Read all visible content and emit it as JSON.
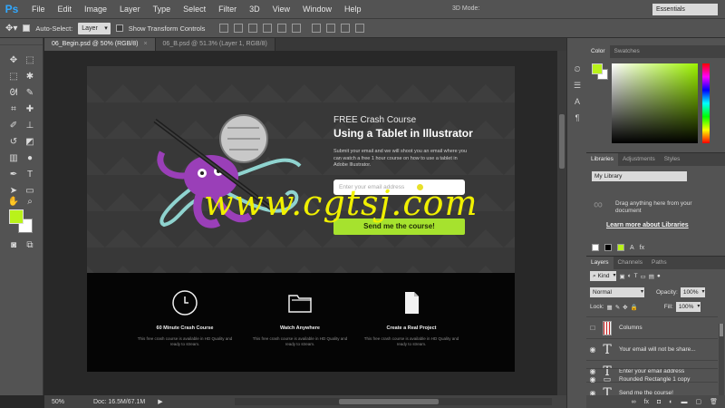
{
  "app": {
    "logo": "Ps",
    "menu": [
      "File",
      "Edit",
      "Image",
      "Layer",
      "Type",
      "Select",
      "Filter",
      "3D",
      "View",
      "Window",
      "Help"
    ],
    "window_controls": [
      "–",
      "□",
      "✕"
    ]
  },
  "options_bar": {
    "auto_select_label": "Auto-Select:",
    "auto_select_value": "Layer",
    "transform_label": "Show Transform Controls",
    "mode_3d_label": "3D Mode:",
    "workspace": "Essentials"
  },
  "tabs": [
    {
      "label": "06_Begin.psd @ 50% (RGB/8)",
      "active": true
    },
    {
      "label": "06_B.psd @ 51.3% (Layer 1, RGB/8)",
      "active": false
    }
  ],
  "tool_icons": [
    "move-icon",
    "marquee-icon",
    "lasso-icon",
    "quick-select-icon",
    "crop-icon",
    "eyedropper-icon",
    "healing-icon",
    "brush-icon",
    "stamp-icon",
    "history-brush-icon",
    "eraser-icon",
    "gradient-icon",
    "blur-icon",
    "dodge-icon",
    "pen-icon",
    "type-icon",
    "path-select-icon",
    "shape-icon",
    "hand-icon",
    "zoom-icon"
  ],
  "colors": {
    "foreground": "#b9f21a",
    "background": "#ffffff",
    "accent_button": "#a6e22e"
  },
  "document": {
    "hero": {
      "eyebrow": "FREE Crash Course",
      "title": "Using a Tablet in Illustrator",
      "description": "Submit your email and we will shoot you an email where you can watch a free 1 hour course on how to use a tablet in Adobe Illustrator.",
      "email_placeholder": "Enter your email address",
      "cta": "Send me the course!"
    },
    "features": [
      {
        "icon": "clock-icon",
        "title": "60 Minute Crash Course",
        "desc": "This free crash course is available in HD Quality and ready to stream."
      },
      {
        "icon": "folder-icon",
        "title": "Watch Anywhere",
        "desc": "This free crash course is available in HD Quality and ready to stream."
      },
      {
        "icon": "document-icon",
        "title": "Create a Real Project",
        "desc": "This free crash course is available in HD Quality and ready to stream."
      }
    ],
    "watermark": "www.cgtsj.com"
  },
  "status": {
    "zoom": "50%",
    "doc_size": "Doc: 16.5M/67.1M"
  },
  "panels": {
    "color_tabs": [
      "Color",
      "Swatches"
    ],
    "library_tabs": [
      "Libraries",
      "Adjustments",
      "Styles"
    ],
    "library_name": "My Library",
    "library_drag_text": "Drag anything here from your document",
    "library_learn": "Learn more about Libraries",
    "layers_tabs": [
      "Layers",
      "Channels",
      "Paths"
    ],
    "filter_kind": "Kind",
    "blend_mode": "Normal",
    "opacity_label": "Opacity:",
    "opacity": "100%",
    "lock_label": "Lock:",
    "fill_label": "Fill:",
    "fill": "100%",
    "layers": [
      {
        "name": "Columns",
        "type": "image",
        "visible": false
      },
      {
        "name": "Your email will not be share...",
        "type": "text",
        "visible": true
      },
      {
        "name": "Enter your email address",
        "type": "text",
        "visible": true
      },
      {
        "name": "Send me the course!",
        "type": "text",
        "visible": true
      },
      {
        "name": "Rounded Rectangle 1 copy",
        "type": "shape",
        "visible": true
      }
    ],
    "layer_text_glyph": "T"
  }
}
